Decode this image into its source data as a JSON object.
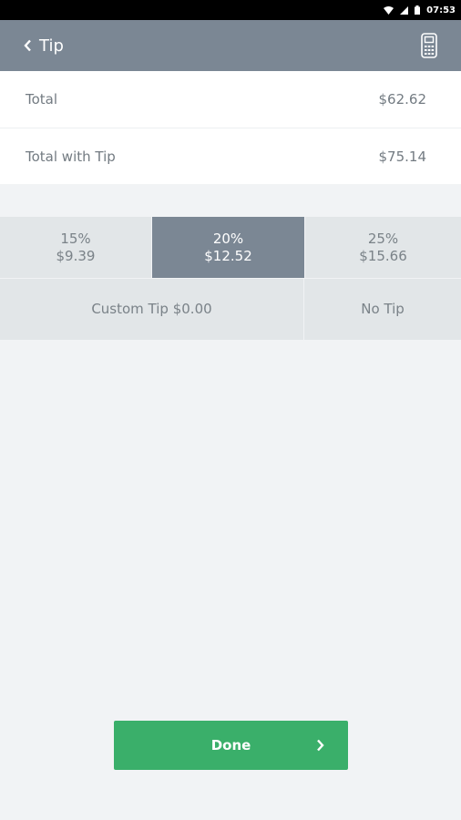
{
  "status_bar": {
    "time": "07:53"
  },
  "header": {
    "title": "Tip",
    "back_icon": "chevron-left-icon",
    "action_icon": "card-reader-icon"
  },
  "summary": {
    "total_label": "Total",
    "total_value": "$62.62",
    "with_tip_label": "Total with Tip",
    "with_tip_value": "$75.14"
  },
  "tip_options": [
    {
      "percent": "15%",
      "amount": "$9.39",
      "selected": false
    },
    {
      "percent": "20%",
      "amount": "$12.52",
      "selected": true
    },
    {
      "percent": "25%",
      "amount": "$15.66",
      "selected": false
    }
  ],
  "custom_tip_label": "Custom Tip $0.00",
  "no_tip_label": "No Tip",
  "done_label": "Done",
  "colors": {
    "header": "#7b8794",
    "selected_tip": "#7b8794",
    "done_button": "#3aaf6a"
  }
}
